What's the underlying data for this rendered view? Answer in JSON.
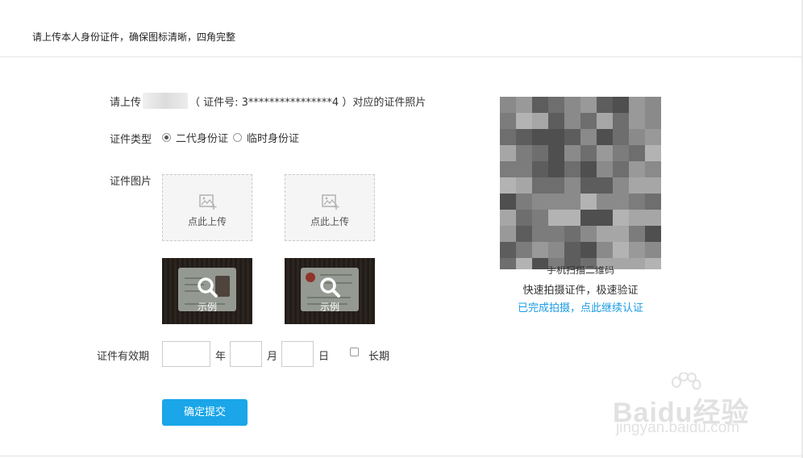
{
  "header": {
    "text": "请上传本人身份证件，确保图标清晰，四角完整"
  },
  "intro": {
    "prefix": "请上传",
    "id_part": "（ 证件号: 3****************4 ）对应的证件照片"
  },
  "form": {
    "type_label": "证件类型",
    "options": [
      {
        "label": "二代身份证",
        "checked": true
      },
      {
        "label": "临时身份证",
        "checked": false
      }
    ],
    "image_label": "证件图片",
    "upload_text": "点此上传",
    "example_text": "示例",
    "validity_label": "证件有效期",
    "year_unit": "年",
    "month_unit": "月",
    "day_unit": "日",
    "long_term": "长期",
    "submit": "确定提交"
  },
  "qr": {
    "line1": "手机扫描二维码",
    "line2": "快速拍摄证件，极速验证",
    "link": "已完成拍摄，点此继续认证"
  },
  "watermark": {
    "brand": "Baidu经验",
    "url": "jingyan.baidu.com"
  },
  "colors": {
    "accent": "#1aa6e8",
    "link": "#1a9be6"
  }
}
